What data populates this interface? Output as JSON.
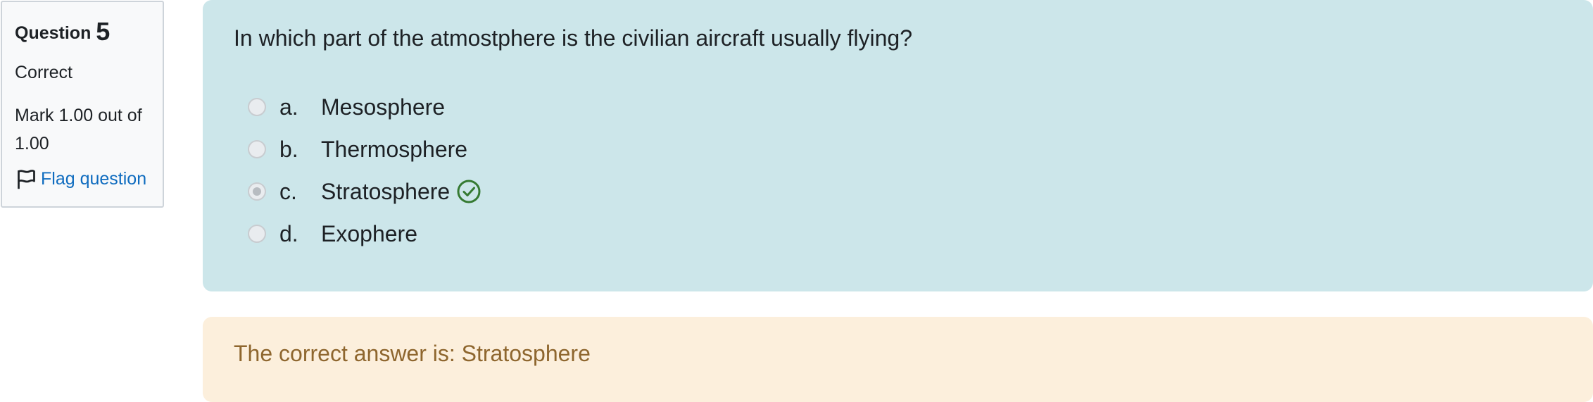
{
  "info": {
    "question_label": "Question",
    "question_number": "5",
    "state": "Correct",
    "grade": "Mark 1.00 out of 1.00",
    "flag_label": "Flag question",
    "flag_icon": "flag-outline-icon"
  },
  "question": {
    "text": "In which part of the atmostphere is the civilian aircraft usually flying?",
    "answers": [
      {
        "letter": "a.",
        "text": "Mesosphere",
        "selected": false
      },
      {
        "letter": "b.",
        "text": "Thermosphere",
        "selected": false
      },
      {
        "letter": "c.",
        "text": "Stratosphere",
        "selected": true,
        "marked_correct": true,
        "icon": "check-circle-icon"
      },
      {
        "letter": "d.",
        "text": "Exophere",
        "selected": false
      }
    ]
  },
  "feedback": {
    "right_answer": "The correct answer is: Stratosphere"
  },
  "colors": {
    "content_bg": "#cce6ea",
    "feedback_bg": "#fcefdc",
    "feedback_text": "#8e662e",
    "link": "#0f6cbf",
    "correct_icon": "#357a32",
    "info_bg": "#f8f9fa"
  }
}
